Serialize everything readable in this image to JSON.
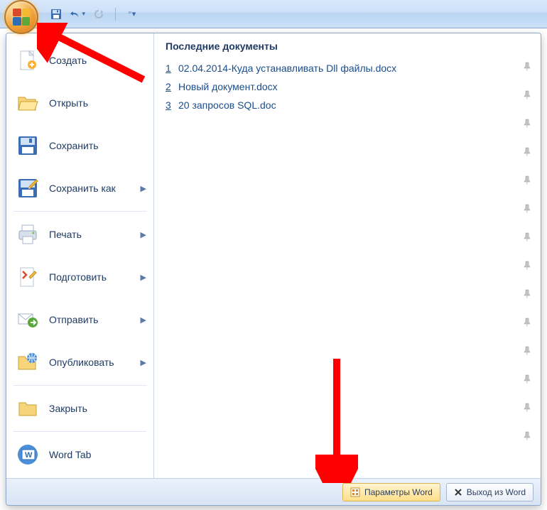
{
  "qat": {
    "save_tooltip": "Сохранить",
    "undo_tooltip": "Отменить",
    "redo_tooltip": "Повторить"
  },
  "menu": {
    "items": [
      {
        "label": "Создать",
        "has_submenu": false
      },
      {
        "label": "Открыть",
        "has_submenu": false
      },
      {
        "label": "Сохранить",
        "has_submenu": false
      },
      {
        "label": "Сохранить как",
        "has_submenu": true
      },
      {
        "label": "Печать",
        "has_submenu": true
      },
      {
        "label": "Подготовить",
        "has_submenu": true
      },
      {
        "label": "Отправить",
        "has_submenu": true
      },
      {
        "label": "Опубликовать",
        "has_submenu": true
      },
      {
        "label": "Закрыть",
        "has_submenu": false
      },
      {
        "label": "Word Tab",
        "has_submenu": false
      }
    ]
  },
  "recent": {
    "title": "Последние документы",
    "docs": [
      {
        "num": "1",
        "name": "02.04.2014-Куда устанавливать Dll файлы.docx"
      },
      {
        "num": "2",
        "name": "Новый документ.docx"
      },
      {
        "num": "3",
        "name": "20 запросов SQL.doc"
      }
    ]
  },
  "bottom": {
    "options_label": "Параметры Word",
    "exit_label": "Выход из Word"
  }
}
